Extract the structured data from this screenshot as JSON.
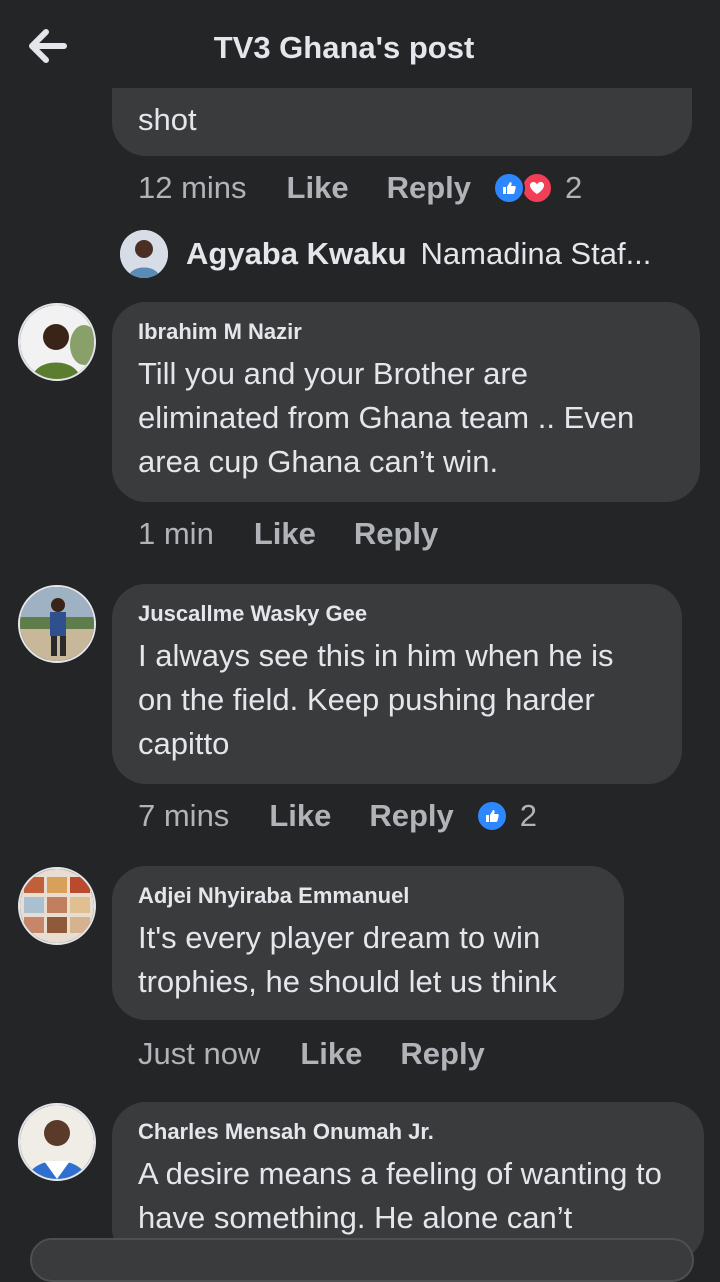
{
  "header": {
    "title": "TV3 Ghana's post",
    "back_icon": "arrow-left-icon"
  },
  "prev_comment": {
    "text_tail": "shot",
    "time": "12 mins",
    "like": "Like",
    "reply": "Reply",
    "reactions": [
      "like",
      "love"
    ],
    "reaction_count": "2",
    "reply_preview": {
      "name": "Agyaba Kwaku",
      "text": "Namadina Staf..."
    }
  },
  "comments": [
    {
      "name": "Ibrahim M Nazir",
      "text": "Till you and your Brother are eliminated from Ghana team .. Even area cup Ghana can’t win.",
      "time": "1 min",
      "like": "Like",
      "reply": "Reply"
    },
    {
      "name": "Juscallme Wasky Gee",
      "text": "I always see this in him when he is on the field. Keep pushing harder capitto",
      "time": "7 mins",
      "like": "Like",
      "reply": "Reply",
      "reactions": [
        "like"
      ],
      "reaction_count": "2"
    },
    {
      "name": "Adjei Nhyiraba Emmanuel",
      "text": "It's every player dream to win trophies, he should let us think",
      "time": "Just now",
      "like": "Like",
      "reply": "Reply"
    },
    {
      "name": "Charles Mensah Onumah Jr.",
      "text": "A desire means a feeling of wanting to have something. He alone can’t"
    }
  ],
  "colors": {
    "background": "#242526",
    "bubble": "#3a3b3c",
    "primary_text": "#e4e6eb",
    "secondary_text": "#b0b3b8",
    "like_blue": "#2d88ff",
    "love_red": "#f33e58"
  }
}
